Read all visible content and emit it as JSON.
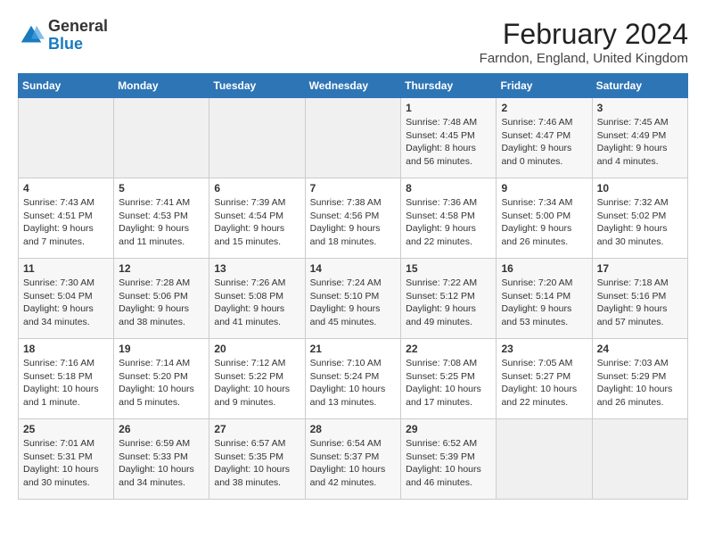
{
  "header": {
    "logo_general": "General",
    "logo_blue": "Blue",
    "title": "February 2024",
    "location": "Farndon, England, United Kingdom"
  },
  "days_of_week": [
    "Sunday",
    "Monday",
    "Tuesday",
    "Wednesday",
    "Thursday",
    "Friday",
    "Saturday"
  ],
  "weeks": [
    [
      {
        "day": "",
        "info": ""
      },
      {
        "day": "",
        "info": ""
      },
      {
        "day": "",
        "info": ""
      },
      {
        "day": "",
        "info": ""
      },
      {
        "day": "1",
        "info": "Sunrise: 7:48 AM\nSunset: 4:45 PM\nDaylight: 8 hours\nand 56 minutes."
      },
      {
        "day": "2",
        "info": "Sunrise: 7:46 AM\nSunset: 4:47 PM\nDaylight: 9 hours\nand 0 minutes."
      },
      {
        "day": "3",
        "info": "Sunrise: 7:45 AM\nSunset: 4:49 PM\nDaylight: 9 hours\nand 4 minutes."
      }
    ],
    [
      {
        "day": "4",
        "info": "Sunrise: 7:43 AM\nSunset: 4:51 PM\nDaylight: 9 hours\nand 7 minutes."
      },
      {
        "day": "5",
        "info": "Sunrise: 7:41 AM\nSunset: 4:53 PM\nDaylight: 9 hours\nand 11 minutes."
      },
      {
        "day": "6",
        "info": "Sunrise: 7:39 AM\nSunset: 4:54 PM\nDaylight: 9 hours\nand 15 minutes."
      },
      {
        "day": "7",
        "info": "Sunrise: 7:38 AM\nSunset: 4:56 PM\nDaylight: 9 hours\nand 18 minutes."
      },
      {
        "day": "8",
        "info": "Sunrise: 7:36 AM\nSunset: 4:58 PM\nDaylight: 9 hours\nand 22 minutes."
      },
      {
        "day": "9",
        "info": "Sunrise: 7:34 AM\nSunset: 5:00 PM\nDaylight: 9 hours\nand 26 minutes."
      },
      {
        "day": "10",
        "info": "Sunrise: 7:32 AM\nSunset: 5:02 PM\nDaylight: 9 hours\nand 30 minutes."
      }
    ],
    [
      {
        "day": "11",
        "info": "Sunrise: 7:30 AM\nSunset: 5:04 PM\nDaylight: 9 hours\nand 34 minutes."
      },
      {
        "day": "12",
        "info": "Sunrise: 7:28 AM\nSunset: 5:06 PM\nDaylight: 9 hours\nand 38 minutes."
      },
      {
        "day": "13",
        "info": "Sunrise: 7:26 AM\nSunset: 5:08 PM\nDaylight: 9 hours\nand 41 minutes."
      },
      {
        "day": "14",
        "info": "Sunrise: 7:24 AM\nSunset: 5:10 PM\nDaylight: 9 hours\nand 45 minutes."
      },
      {
        "day": "15",
        "info": "Sunrise: 7:22 AM\nSunset: 5:12 PM\nDaylight: 9 hours\nand 49 minutes."
      },
      {
        "day": "16",
        "info": "Sunrise: 7:20 AM\nSunset: 5:14 PM\nDaylight: 9 hours\nand 53 minutes."
      },
      {
        "day": "17",
        "info": "Sunrise: 7:18 AM\nSunset: 5:16 PM\nDaylight: 9 hours\nand 57 minutes."
      }
    ],
    [
      {
        "day": "18",
        "info": "Sunrise: 7:16 AM\nSunset: 5:18 PM\nDaylight: 10 hours\nand 1 minute."
      },
      {
        "day": "19",
        "info": "Sunrise: 7:14 AM\nSunset: 5:20 PM\nDaylight: 10 hours\nand 5 minutes."
      },
      {
        "day": "20",
        "info": "Sunrise: 7:12 AM\nSunset: 5:22 PM\nDaylight: 10 hours\nand 9 minutes."
      },
      {
        "day": "21",
        "info": "Sunrise: 7:10 AM\nSunset: 5:24 PM\nDaylight: 10 hours\nand 13 minutes."
      },
      {
        "day": "22",
        "info": "Sunrise: 7:08 AM\nSunset: 5:25 PM\nDaylight: 10 hours\nand 17 minutes."
      },
      {
        "day": "23",
        "info": "Sunrise: 7:05 AM\nSunset: 5:27 PM\nDaylight: 10 hours\nand 22 minutes."
      },
      {
        "day": "24",
        "info": "Sunrise: 7:03 AM\nSunset: 5:29 PM\nDaylight: 10 hours\nand 26 minutes."
      }
    ],
    [
      {
        "day": "25",
        "info": "Sunrise: 7:01 AM\nSunset: 5:31 PM\nDaylight: 10 hours\nand 30 minutes."
      },
      {
        "day": "26",
        "info": "Sunrise: 6:59 AM\nSunset: 5:33 PM\nDaylight: 10 hours\nand 34 minutes."
      },
      {
        "day": "27",
        "info": "Sunrise: 6:57 AM\nSunset: 5:35 PM\nDaylight: 10 hours\nand 38 minutes."
      },
      {
        "day": "28",
        "info": "Sunrise: 6:54 AM\nSunset: 5:37 PM\nDaylight: 10 hours\nand 42 minutes."
      },
      {
        "day": "29",
        "info": "Sunrise: 6:52 AM\nSunset: 5:39 PM\nDaylight: 10 hours\nand 46 minutes."
      },
      {
        "day": "",
        "info": ""
      },
      {
        "day": "",
        "info": ""
      }
    ]
  ]
}
